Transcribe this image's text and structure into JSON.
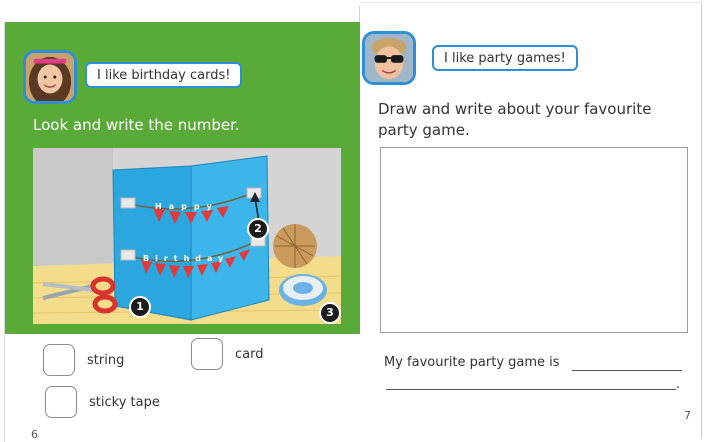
{
  "left_page": {
    "speech": "I like birthday cards!",
    "instruction": "Look and write the number.",
    "card_word_1": "Happy",
    "card_word_2": "Birthday",
    "markers": [
      "1",
      "2",
      "3"
    ],
    "options": [
      {
        "label": "string"
      },
      {
        "label": "card"
      },
      {
        "label": "sticky tape"
      }
    ],
    "page_number": "6"
  },
  "right_page": {
    "speech": "I like party games!",
    "instruction": "Draw and write about your favourite party game.",
    "sentence_start": "My favourite party game is",
    "sentence_end": ".",
    "page_number": "7"
  },
  "colors": {
    "green_panel": "#5aaa3a",
    "bubble_border": "#2e8fd6",
    "card_blue": "#2ca6df",
    "bunting_red": "#e03a3a"
  }
}
